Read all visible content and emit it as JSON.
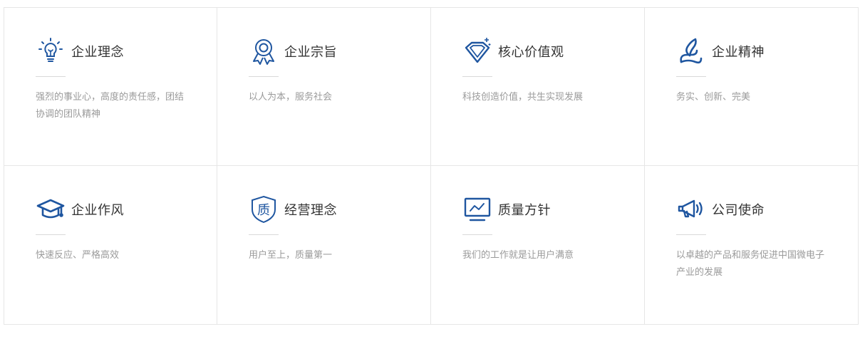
{
  "brand_color": "#1f56a0",
  "cards": [
    {
      "icon": "lightbulb-icon",
      "title": "企业理念",
      "desc": "强烈的事业心，高度的责任感，团结协调的团队精神"
    },
    {
      "icon": "award-ribbon-icon",
      "title": "企业宗旨",
      "desc": "以人为本，服务社会"
    },
    {
      "icon": "diamond-icon",
      "title": "核心价值观",
      "desc": "科技创造价值，共生实现发展"
    },
    {
      "icon": "plant-sprout-icon",
      "title": "企业精神",
      "desc": "务实、创新、完美"
    },
    {
      "icon": "graduation-cap-icon",
      "title": "企业作风",
      "desc": "快速反应、严格高效"
    },
    {
      "icon": "quality-shield-icon",
      "title": "经营理念",
      "desc": "用户至上，质量第一"
    },
    {
      "icon": "monitor-chart-icon",
      "title": "质量方针",
      "desc": "我们的工作就是让用户满意"
    },
    {
      "icon": "megaphone-icon",
      "title": "公司使命",
      "desc": "以卓越的产品和服务促进中国微电子产业的发展"
    }
  ]
}
